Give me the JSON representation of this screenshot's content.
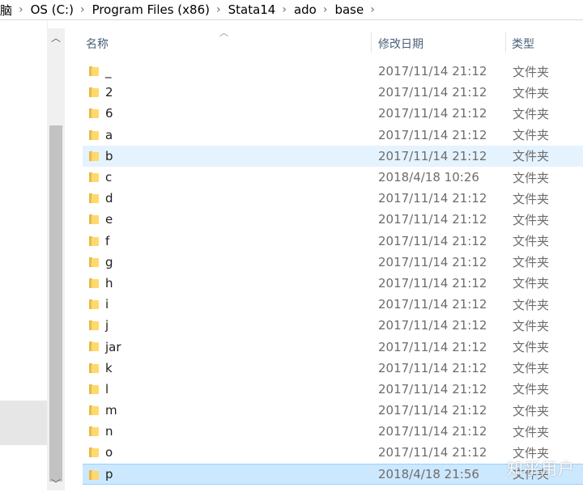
{
  "breadcrumb": [
    "脑",
    "OS (C:)",
    "Program Files (x86)",
    "Stata14",
    "ado",
    "base"
  ],
  "header": {
    "name_label": "名称",
    "date_label": "修改日期",
    "type_label": "类型",
    "sort_icon": "chevron-up-icon"
  },
  "rows": [
    {
      "name": "_",
      "date": "2017/11/14 21:12",
      "type": "文件夹"
    },
    {
      "name": "2",
      "date": "2017/11/14 21:12",
      "type": "文件夹"
    },
    {
      "name": "6",
      "date": "2017/11/14 21:12",
      "type": "文件夹"
    },
    {
      "name": "a",
      "date": "2017/11/14 21:12",
      "type": "文件夹"
    },
    {
      "name": "b",
      "date": "2017/11/14 21:12",
      "type": "文件夹"
    },
    {
      "name": "c",
      "date": "2018/4/18 10:26",
      "type": "文件夹"
    },
    {
      "name": "d",
      "date": "2017/11/14 21:12",
      "type": "文件夹"
    },
    {
      "name": "e",
      "date": "2017/11/14 21:12",
      "type": "文件夹"
    },
    {
      "name": "f",
      "date": "2017/11/14 21:12",
      "type": "文件夹"
    },
    {
      "name": "g",
      "date": "2017/11/14 21:12",
      "type": "文件夹"
    },
    {
      "name": "h",
      "date": "2017/11/14 21:12",
      "type": "文件夹"
    },
    {
      "name": "i",
      "date": "2017/11/14 21:12",
      "type": "文件夹"
    },
    {
      "name": "j",
      "date": "2017/11/14 21:12",
      "type": "文件夹"
    },
    {
      "name": "jar",
      "date": "2017/11/14 21:12",
      "type": "文件夹"
    },
    {
      "name": "k",
      "date": "2017/11/14 21:12",
      "type": "文件夹"
    },
    {
      "name": "l",
      "date": "2017/11/14 21:12",
      "type": "文件夹"
    },
    {
      "name": "m",
      "date": "2017/11/14 21:12",
      "type": "文件夹"
    },
    {
      "name": "n",
      "date": "2017/11/14 21:12",
      "type": "文件夹"
    },
    {
      "name": "o",
      "date": "2017/11/14 21:12",
      "type": "文件夹"
    },
    {
      "name": "p",
      "date": "2018/4/18 21:56",
      "type": "文件夹"
    }
  ],
  "hover_row": "b",
  "selected_row": "p",
  "scrollbar": {
    "up_icon": "chevron-up-icon",
    "down_icon": "chevron-down-icon"
  },
  "watermark": "知乎用户",
  "colors": {
    "hover": "#e5f3ff",
    "selected": "#cce8ff",
    "folder": "#ffd96b"
  }
}
